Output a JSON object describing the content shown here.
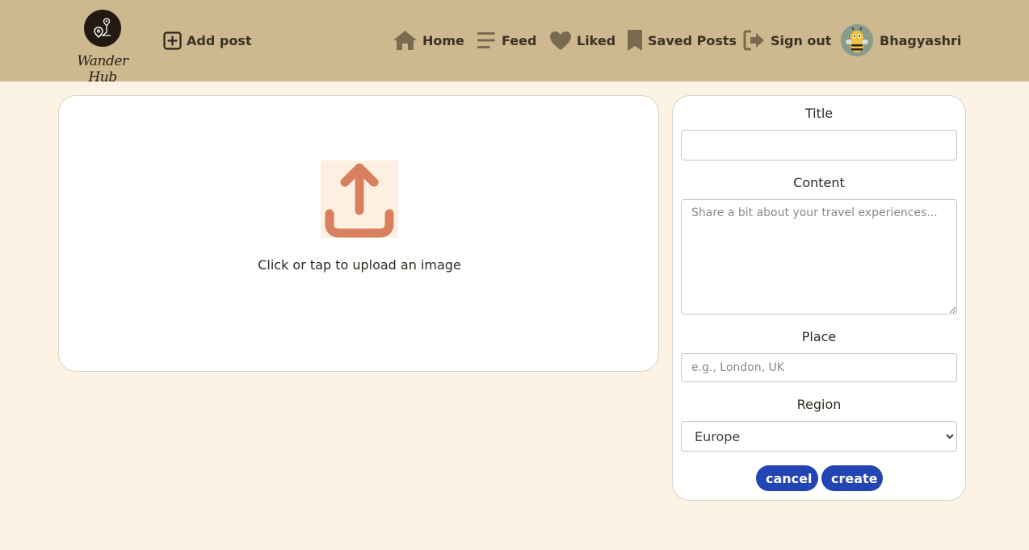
{
  "header": {
    "logo_text": "Wander Hub",
    "add_post": "Add post",
    "nav": {
      "home": "Home",
      "feed": "Feed",
      "liked": "Liked",
      "saved": "Saved Posts",
      "signout": "Sign out",
      "user": "Bhagyashri"
    }
  },
  "upload": {
    "text": "Click or tap to upload an image"
  },
  "form": {
    "title_label": "Title",
    "title_value": "",
    "content_label": "Content",
    "content_placeholder": "Share a bit about your travel experiences...",
    "place_label": "Place",
    "place_placeholder": "e.g., London, UK",
    "region_label": "Region",
    "region_value": "Europe",
    "cancel": "cancel",
    "create": "create"
  },
  "colors": {
    "header_bg": "#cdb88f",
    "page_bg": "#fdf3e4",
    "upload_icon": "#d9805e",
    "button": "#2344b3",
    "nav_icon": "#7a6a4f"
  }
}
